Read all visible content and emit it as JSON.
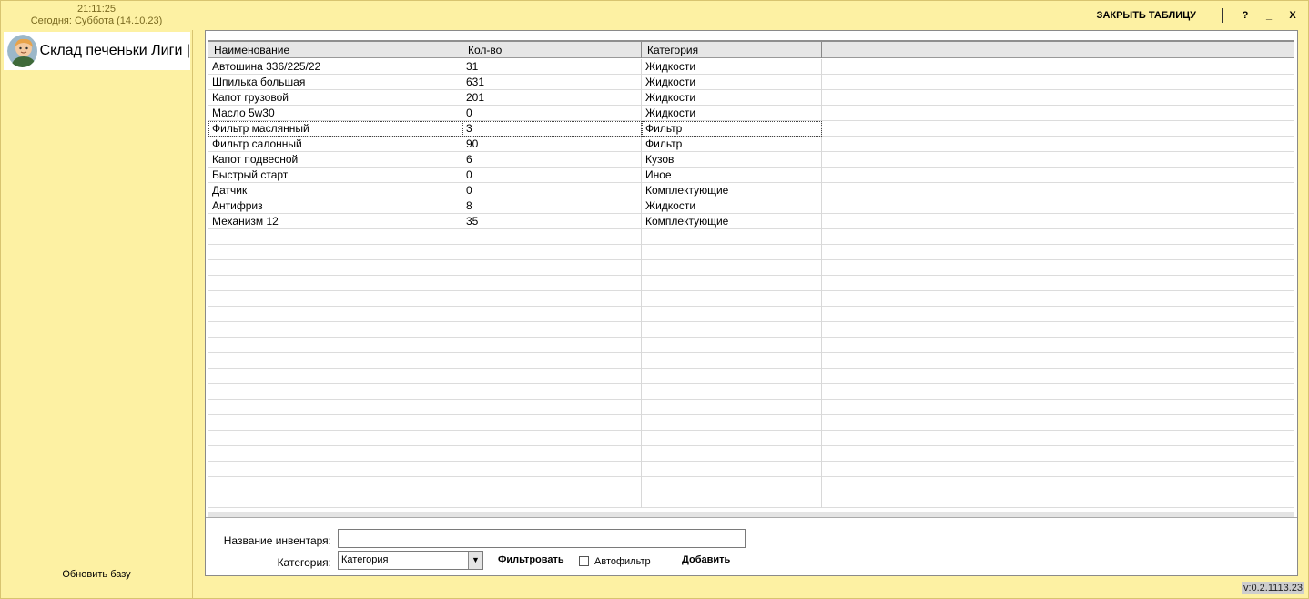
{
  "clock": {
    "time": "21:11:25",
    "date": "Сегодня: Суббота (14.10.23)"
  },
  "toolbar": {
    "close_table": "ЗАКРЫТЬ ТАБЛИЦУ",
    "help": "?",
    "minimize": "_",
    "close": "X"
  },
  "sidebar": {
    "title": "Склад печеньки Лиги |",
    "refresh": "Обновить базу"
  },
  "table": {
    "headers": [
      "Наименование",
      "Кол-во",
      "Категория"
    ],
    "rows": [
      [
        "Автошина 336/225/22",
        "31",
        "Жидкости"
      ],
      [
        "Шпилька большая",
        "631",
        "Жидкости"
      ],
      [
        "Капот грузовой",
        "201",
        "Жидкости"
      ],
      [
        "Масло 5w30",
        "0",
        "Жидкости"
      ],
      [
        "Фильтр маслянный",
        "3",
        "Фильтр"
      ],
      [
        "Фильтр салонный",
        "90",
        "Фильтр"
      ],
      [
        "Капот подвесной",
        "6",
        "Кузов"
      ],
      [
        "Быстрый старт",
        "0",
        "Иное"
      ],
      [
        "Датчик",
        "0",
        "Комплектующие"
      ],
      [
        "Антифриз",
        "8",
        "Жидкости"
      ],
      [
        "Механизм 12",
        "35",
        "Комплектующие"
      ]
    ],
    "selected_row": 4
  },
  "form": {
    "name_label": "Название инвентаря:",
    "name_value": "",
    "category_label": "Категория:",
    "category_value": "Категория",
    "filter_button": "Фильтровать",
    "autofilter_label": "Автофильтр",
    "autofilter_checked": false,
    "add_button": "Добавить"
  },
  "version": "v:0.2.1113.23",
  "colors": {
    "background": "#fdf1a3",
    "clock_text": "#7a6a20"
  }
}
